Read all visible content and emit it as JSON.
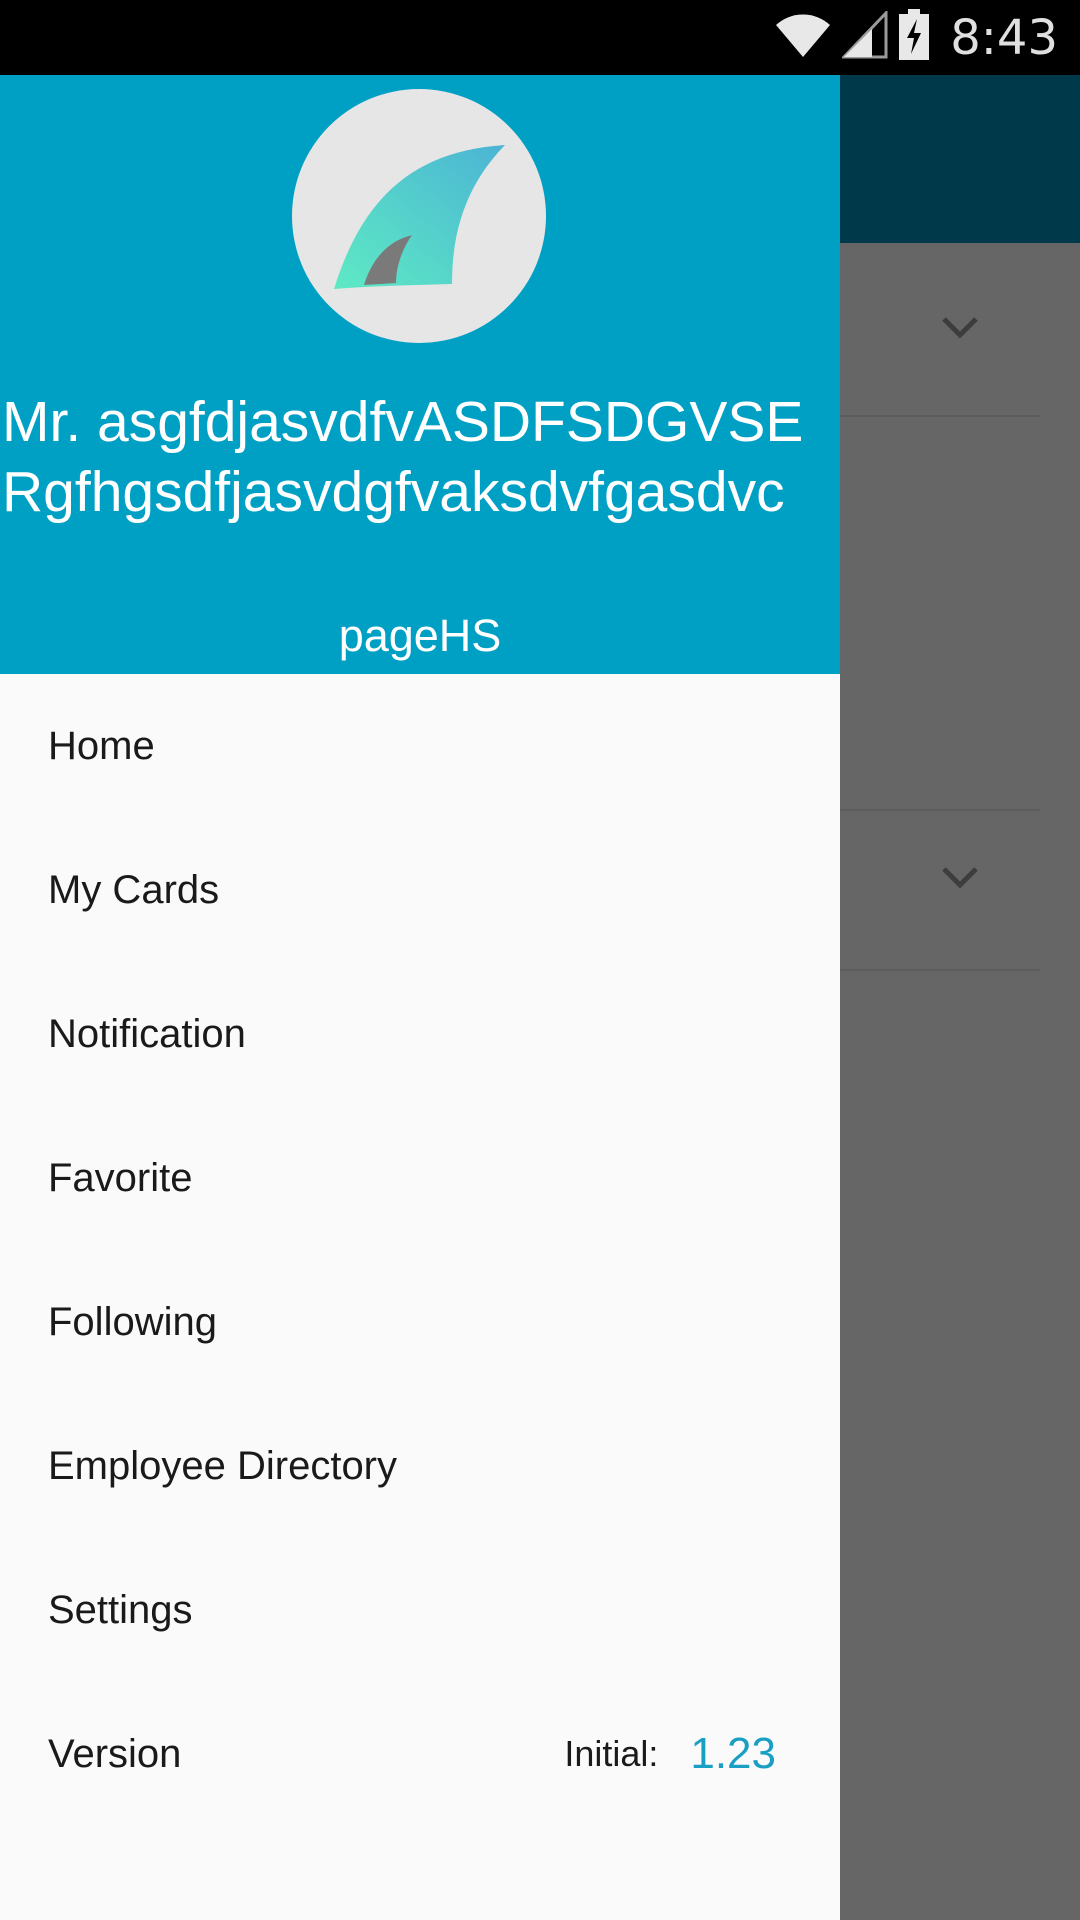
{
  "status_bar": {
    "time": "8:43",
    "icons": [
      "wifi-icon",
      "signal-icon",
      "battery-charging-icon"
    ]
  },
  "drawer": {
    "header": {
      "avatar_icon": "app-logo-icon",
      "name": "Mr. asgfdjasvdfvASDFSDGVSERgfhgsdfjasvdgfvaksdvfgasdvc",
      "page": "pageHS",
      "background_color": "#00a0c4"
    },
    "menu": [
      {
        "label": "Home"
      },
      {
        "label": "My Cards"
      },
      {
        "label": "Notification"
      },
      {
        "label": "Favorite"
      },
      {
        "label": "Following"
      },
      {
        "label": "Employee Directory"
      },
      {
        "label": "Settings"
      },
      {
        "label": "Version"
      }
    ],
    "version": {
      "label": "Initial:",
      "value": "1.23",
      "value_color": "#1a9fc4"
    }
  },
  "background_page": {
    "toolbar_color": "#003a4a",
    "chevrons": [
      "chevron-down-icon",
      "chevron-down-icon"
    ]
  }
}
